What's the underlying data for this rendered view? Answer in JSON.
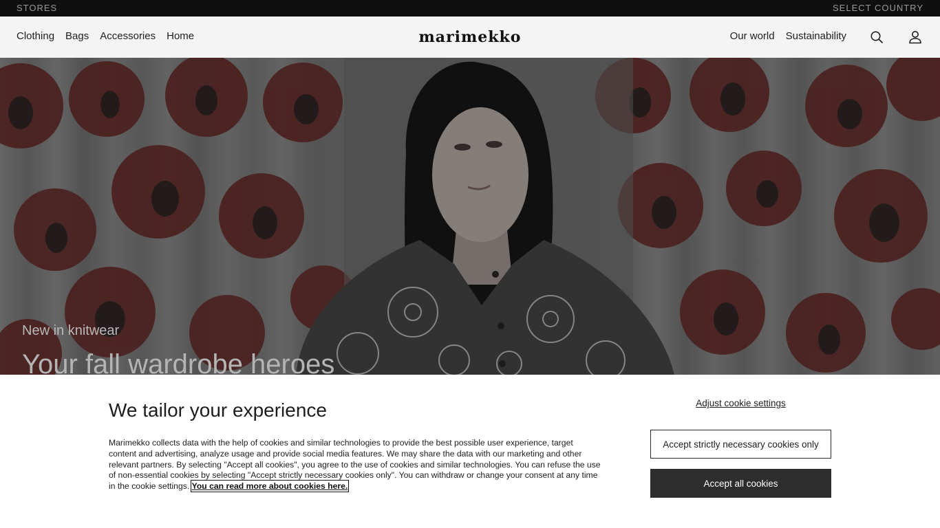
{
  "topbar": {
    "stores": "STORES",
    "select_country": "SELECT COUNTRY"
  },
  "nav": {
    "logo": "marimekko",
    "left_links": [
      "Clothing",
      "Bags",
      "Accessories",
      "Home"
    ],
    "right_links": [
      "Our world",
      "Sustainability"
    ],
    "icons": {
      "search": "search-icon",
      "account": "account-icon"
    }
  },
  "hero": {
    "eyebrow": "New in knitwear",
    "headline": "Your fall wardrobe heroes"
  },
  "cookie": {
    "title": "We tailor your experience",
    "body": "Marimekko collects data with the help of cookies and similar technologies to provide the best possible user experience, target content and advertising, analyze usage and provide social media features. We may share the data with our marketing and other relevant partners. By selecting \"Accept all cookies\", you agree to the use of cookies and similar technologies. You can refuse the use of non-essential cookies by selecting \"Accept strictly necessary cookies only\". You can withdraw or change your consent at any time in the cookie settings.",
    "read_more_link": "You can read more about cookies here.",
    "adjust_link": "Adjust cookie settings",
    "accept_necessary": "Accept strictly necessary cookies only",
    "accept_all": "Accept all cookies"
  },
  "colors": {
    "topbar_bg": "#0f0f0f",
    "nav_bg": "#f4f4f4",
    "poppy": "#5c2b28",
    "accept_all_bg": "#2d2d2d"
  }
}
